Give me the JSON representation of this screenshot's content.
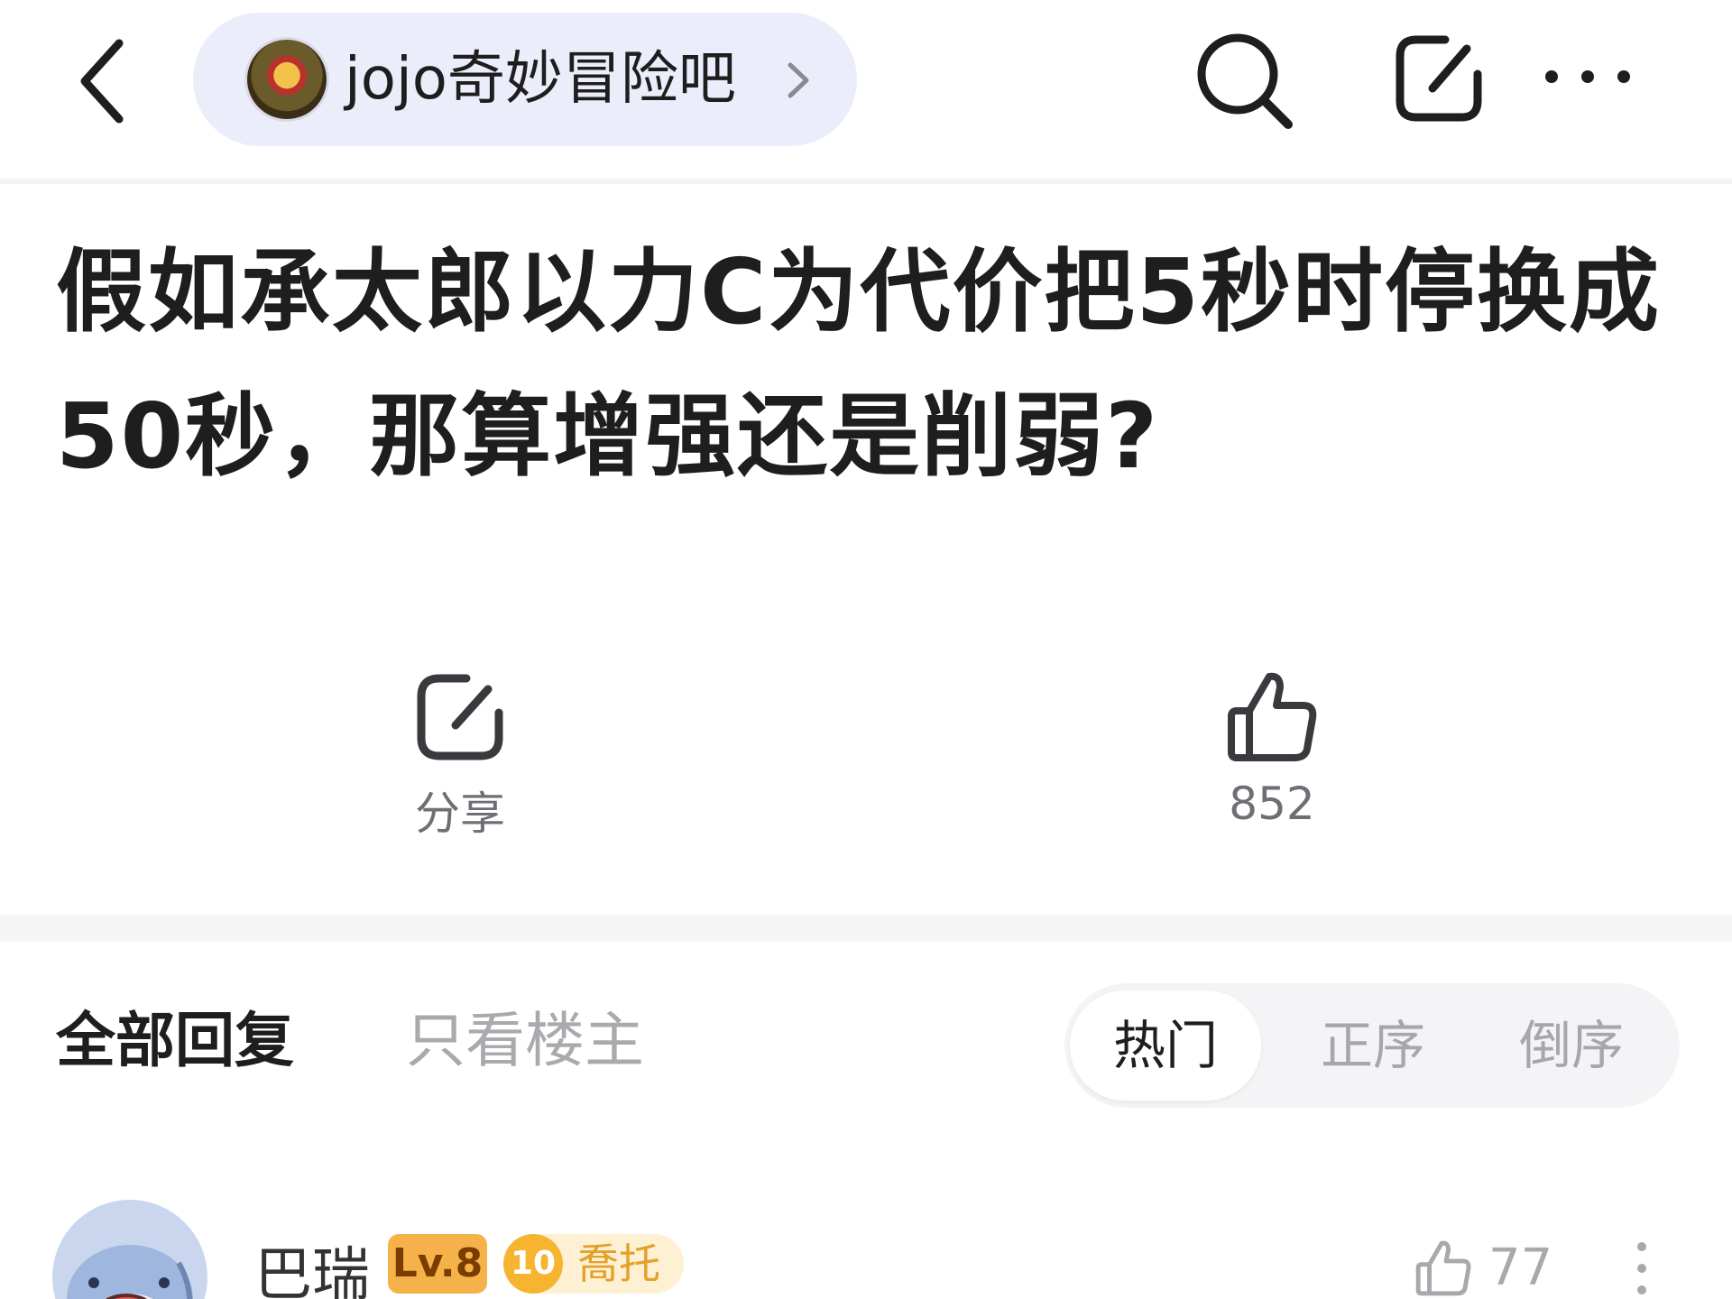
{
  "header": {
    "forum_name": "jojo奇妙冒险吧"
  },
  "post": {
    "title": "假如承太郎以力C为代价把5秒时停换成50秒，那算增强还是削弱?"
  },
  "actions": {
    "share_label": "分享",
    "like_count": "852"
  },
  "reply_tabs": {
    "all_label": "全部回复",
    "op_only_label": "只看楼主",
    "sort_options": [
      "热门",
      "正序",
      "倒序"
    ],
    "active_sort": "热门"
  },
  "reply": {
    "username": "巴瑞",
    "level": "Lv.8",
    "title_badge_level": "10",
    "title_badge_text": "喬托",
    "like_count": "77"
  },
  "colors": {
    "accent_pill": "#ecedfb",
    "level_badge": "#f6b24a",
    "title_badge": "#f7b430",
    "muted_text": "#aaaaae"
  },
  "icons": {
    "back": "chevron-left-icon",
    "search": "search-icon",
    "share": "share-icon",
    "more": "more-horizontal-icon",
    "like": "thumbs-up-icon"
  }
}
